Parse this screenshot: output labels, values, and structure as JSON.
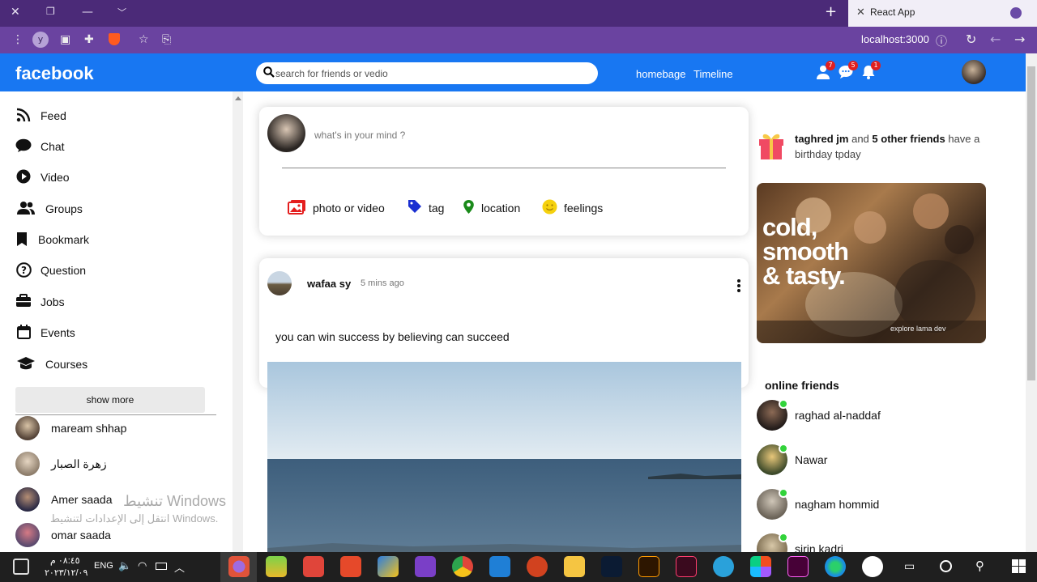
{
  "browser": {
    "tab_title": "React App",
    "url": "localhost:3000",
    "profile_initial": "y"
  },
  "header": {
    "logo": "facebook",
    "search_placeholder": "search for friends or vedio",
    "links": [
      "homebage",
      "Timeline"
    ],
    "badges": {
      "friends": "7",
      "messages": "5",
      "notifications": "1"
    }
  },
  "sidebar": {
    "items": [
      {
        "label": "Feed",
        "icon": "rss-icon"
      },
      {
        "label": "Chat",
        "icon": "chat-icon"
      },
      {
        "label": "Video",
        "icon": "play-circle-icon"
      },
      {
        "label": "Groups",
        "icon": "groups-icon"
      },
      {
        "label": "Bookmark",
        "icon": "bookmark-icon"
      },
      {
        "label": "Question",
        "icon": "question-icon"
      },
      {
        "label": "Jobs",
        "icon": "briefcase-icon"
      },
      {
        "label": "Events",
        "icon": "calendar-icon"
      },
      {
        "label": "Courses",
        "icon": "graduation-cap-icon"
      }
    ],
    "show_more": "show more",
    "friends": [
      "maream shhap",
      "زهرة الصبار",
      "Amer saada",
      "omar saada"
    ]
  },
  "share": {
    "placeholder": "what's in your mind ?",
    "options": [
      "photo or video",
      "tag",
      "location",
      "feelings"
    ]
  },
  "post": {
    "user": "wafaa sy",
    "time": "5 mins ago",
    "text": "you can win success by believing can succeed"
  },
  "rightbar": {
    "birthday_name": "taghred jm",
    "birthday_and": "and",
    "birthday_others": "5 other friends",
    "birthday_rest": "have a birthday tpday",
    "ad_text_1": "cold,",
    "ad_text_2": "smooth",
    "ad_text_3": "& tasty.",
    "ad_sub": "explore lama dev",
    "online_title": "online friends",
    "online": [
      "raghad al-naddaf",
      "Nawar",
      "nagham hommid",
      "sirin kadri"
    ]
  },
  "watermark": {
    "line1": "تنشيط Windows",
    "line2": "انتقل إلى الإعدادات لتنشيط Windows."
  },
  "taskbar": {
    "time": "٠٨:٤٥ م",
    "date": "٢٠٢٣/١٢/٠٩",
    "lang": "ENG"
  },
  "colors": {
    "fb_blue": "#1877f2",
    "online_green": "#32d33a",
    "badge_red": "#e02020"
  }
}
